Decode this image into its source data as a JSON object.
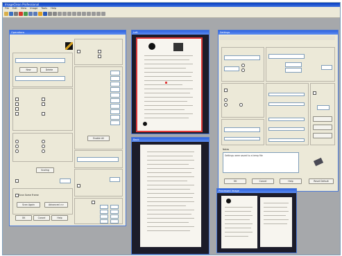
{
  "app": {
    "title": "ImageClean Professional",
    "menu": [
      "File",
      "Edit",
      "View",
      "Image",
      "Tools",
      "Help"
    ]
  },
  "colors": {
    "selection_border": "#e03a3a",
    "window_border": "#4a78d6",
    "titlebar": "#2e63e0",
    "workspace": "#a6a8ab"
  },
  "left_panel": {
    "title": "Operations",
    "buttons": {
      "new": "New",
      "delete": "Delete",
      "enable": "Enable All",
      "scaling": "Scaling",
      "scan_again": "Scan Again",
      "advanced": "Advanced >>",
      "ok": "OK",
      "cancel": "Cancel",
      "help": "Help",
      "disable": "Disable All"
    },
    "checkbox_label": "Scan Same Frame"
  },
  "windows": {
    "main_image": {
      "title": "Left"
    },
    "back_image": {
      "title": "Back"
    },
    "processed_image": {
      "title": "Processed Image"
    }
  },
  "dialog": {
    "title": "Settings",
    "notes_label": "Notes",
    "notes_value": "Settings were saved to a temp file",
    "buttons": {
      "ok": "OK",
      "cancel": "Cancel",
      "help": "Help",
      "reset": "Reset Default"
    }
  }
}
